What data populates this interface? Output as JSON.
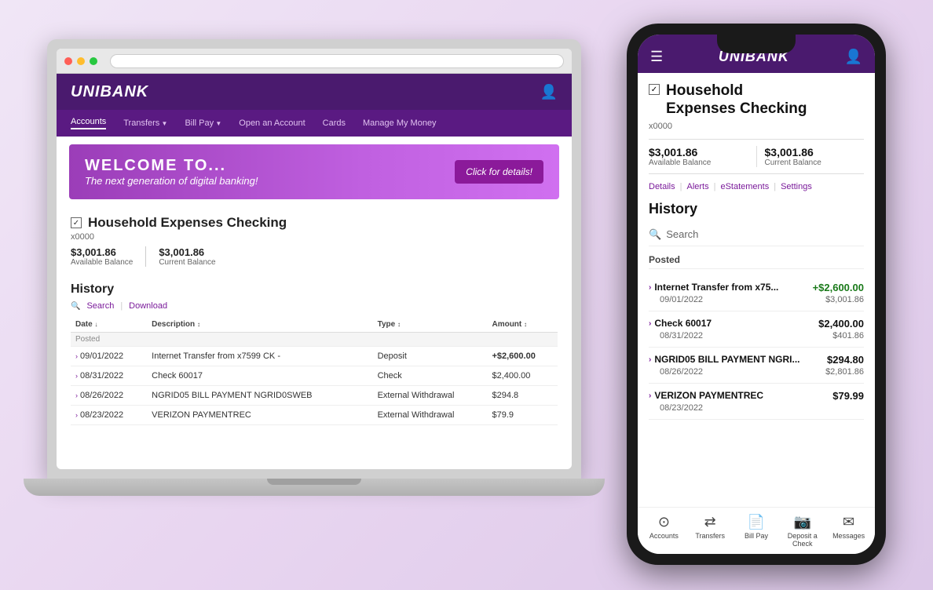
{
  "laptop": {
    "logo": "UNIBANK",
    "nav": {
      "items": [
        {
          "label": "Accounts",
          "active": true
        },
        {
          "label": "Transfers",
          "hasArrow": true
        },
        {
          "label": "Bill Pay",
          "hasArrow": true
        },
        {
          "label": "Open an Account"
        },
        {
          "label": "Cards"
        },
        {
          "label": "Manage My Money"
        }
      ]
    },
    "banner": {
      "line1": "WELCOME TO...",
      "line2": "The next generation of digital banking!",
      "button": "Click for details!"
    },
    "account": {
      "name": "Household Expenses Checking",
      "number": "x0000",
      "available_balance": "$3,001.86",
      "available_label": "Available Balance",
      "current_balance": "$3,001.86",
      "current_label": "Current Balance"
    },
    "history": {
      "title": "History",
      "search": "Search",
      "download": "Download",
      "columns": [
        "Date",
        "Description",
        "Type",
        "Amount"
      ],
      "posted_label": "Posted",
      "transactions": [
        {
          "date": "09/01/2022",
          "desc": "Internet Transfer from x7599 CK -",
          "type": "Deposit",
          "amount": "+$2,600.00",
          "positive": true
        },
        {
          "date": "08/31/2022",
          "desc": "Check 60017",
          "type": "Check",
          "amount": "$2,400.00",
          "positive": false
        },
        {
          "date": "08/26/2022",
          "desc": "NGRID05 BILL PAYMENT NGRID0SWEB",
          "type": "External Withdrawal",
          "amount": "$294.8",
          "positive": false
        },
        {
          "date": "08/23/2022",
          "desc": "VERIZON PAYMENTREC",
          "type": "External Withdrawal",
          "amount": "$79.9",
          "positive": false
        }
      ]
    }
  },
  "phone": {
    "logo": "UNIBANK",
    "account": {
      "name_line1": "Household",
      "name_line2": "Expenses Checking",
      "number": "x0000",
      "available_balance": "$3,001.86",
      "available_label": "Available Balance",
      "current_balance": "$3,001.86",
      "current_label": "Current Balance",
      "links": [
        "Details",
        "Alerts",
        "eStatements",
        "Settings"
      ]
    },
    "history": {
      "title": "History",
      "search_placeholder": "Search",
      "posted_label": "Posted",
      "transactions": [
        {
          "name": "Internet Transfer from x75...",
          "amount": "+$2,600.00",
          "positive": true,
          "date": "09/01/2022",
          "balance": "$3,001.86"
        },
        {
          "name": "Check 60017",
          "amount": "$2,400.00",
          "positive": false,
          "date": "08/31/2022",
          "balance": "$401.86"
        },
        {
          "name": "NGRID05 BILL PAYMENT NGRI...",
          "amount": "$294.80",
          "positive": false,
          "date": "08/26/2022",
          "balance": "$2,801.86"
        },
        {
          "name": "VERIZON PAYMENTREC",
          "amount": "$79.99",
          "positive": false,
          "date": "08/23/2022",
          "balance": ""
        }
      ]
    },
    "bottom_nav": [
      {
        "icon": "⊙",
        "label": "Accounts"
      },
      {
        "icon": "⇄",
        "label": "Transfers"
      },
      {
        "icon": "📄",
        "label": "Bill Pay"
      },
      {
        "icon": "📷",
        "label": "Deposit a Check"
      },
      {
        "icon": "✉",
        "label": "Messages"
      }
    ]
  }
}
